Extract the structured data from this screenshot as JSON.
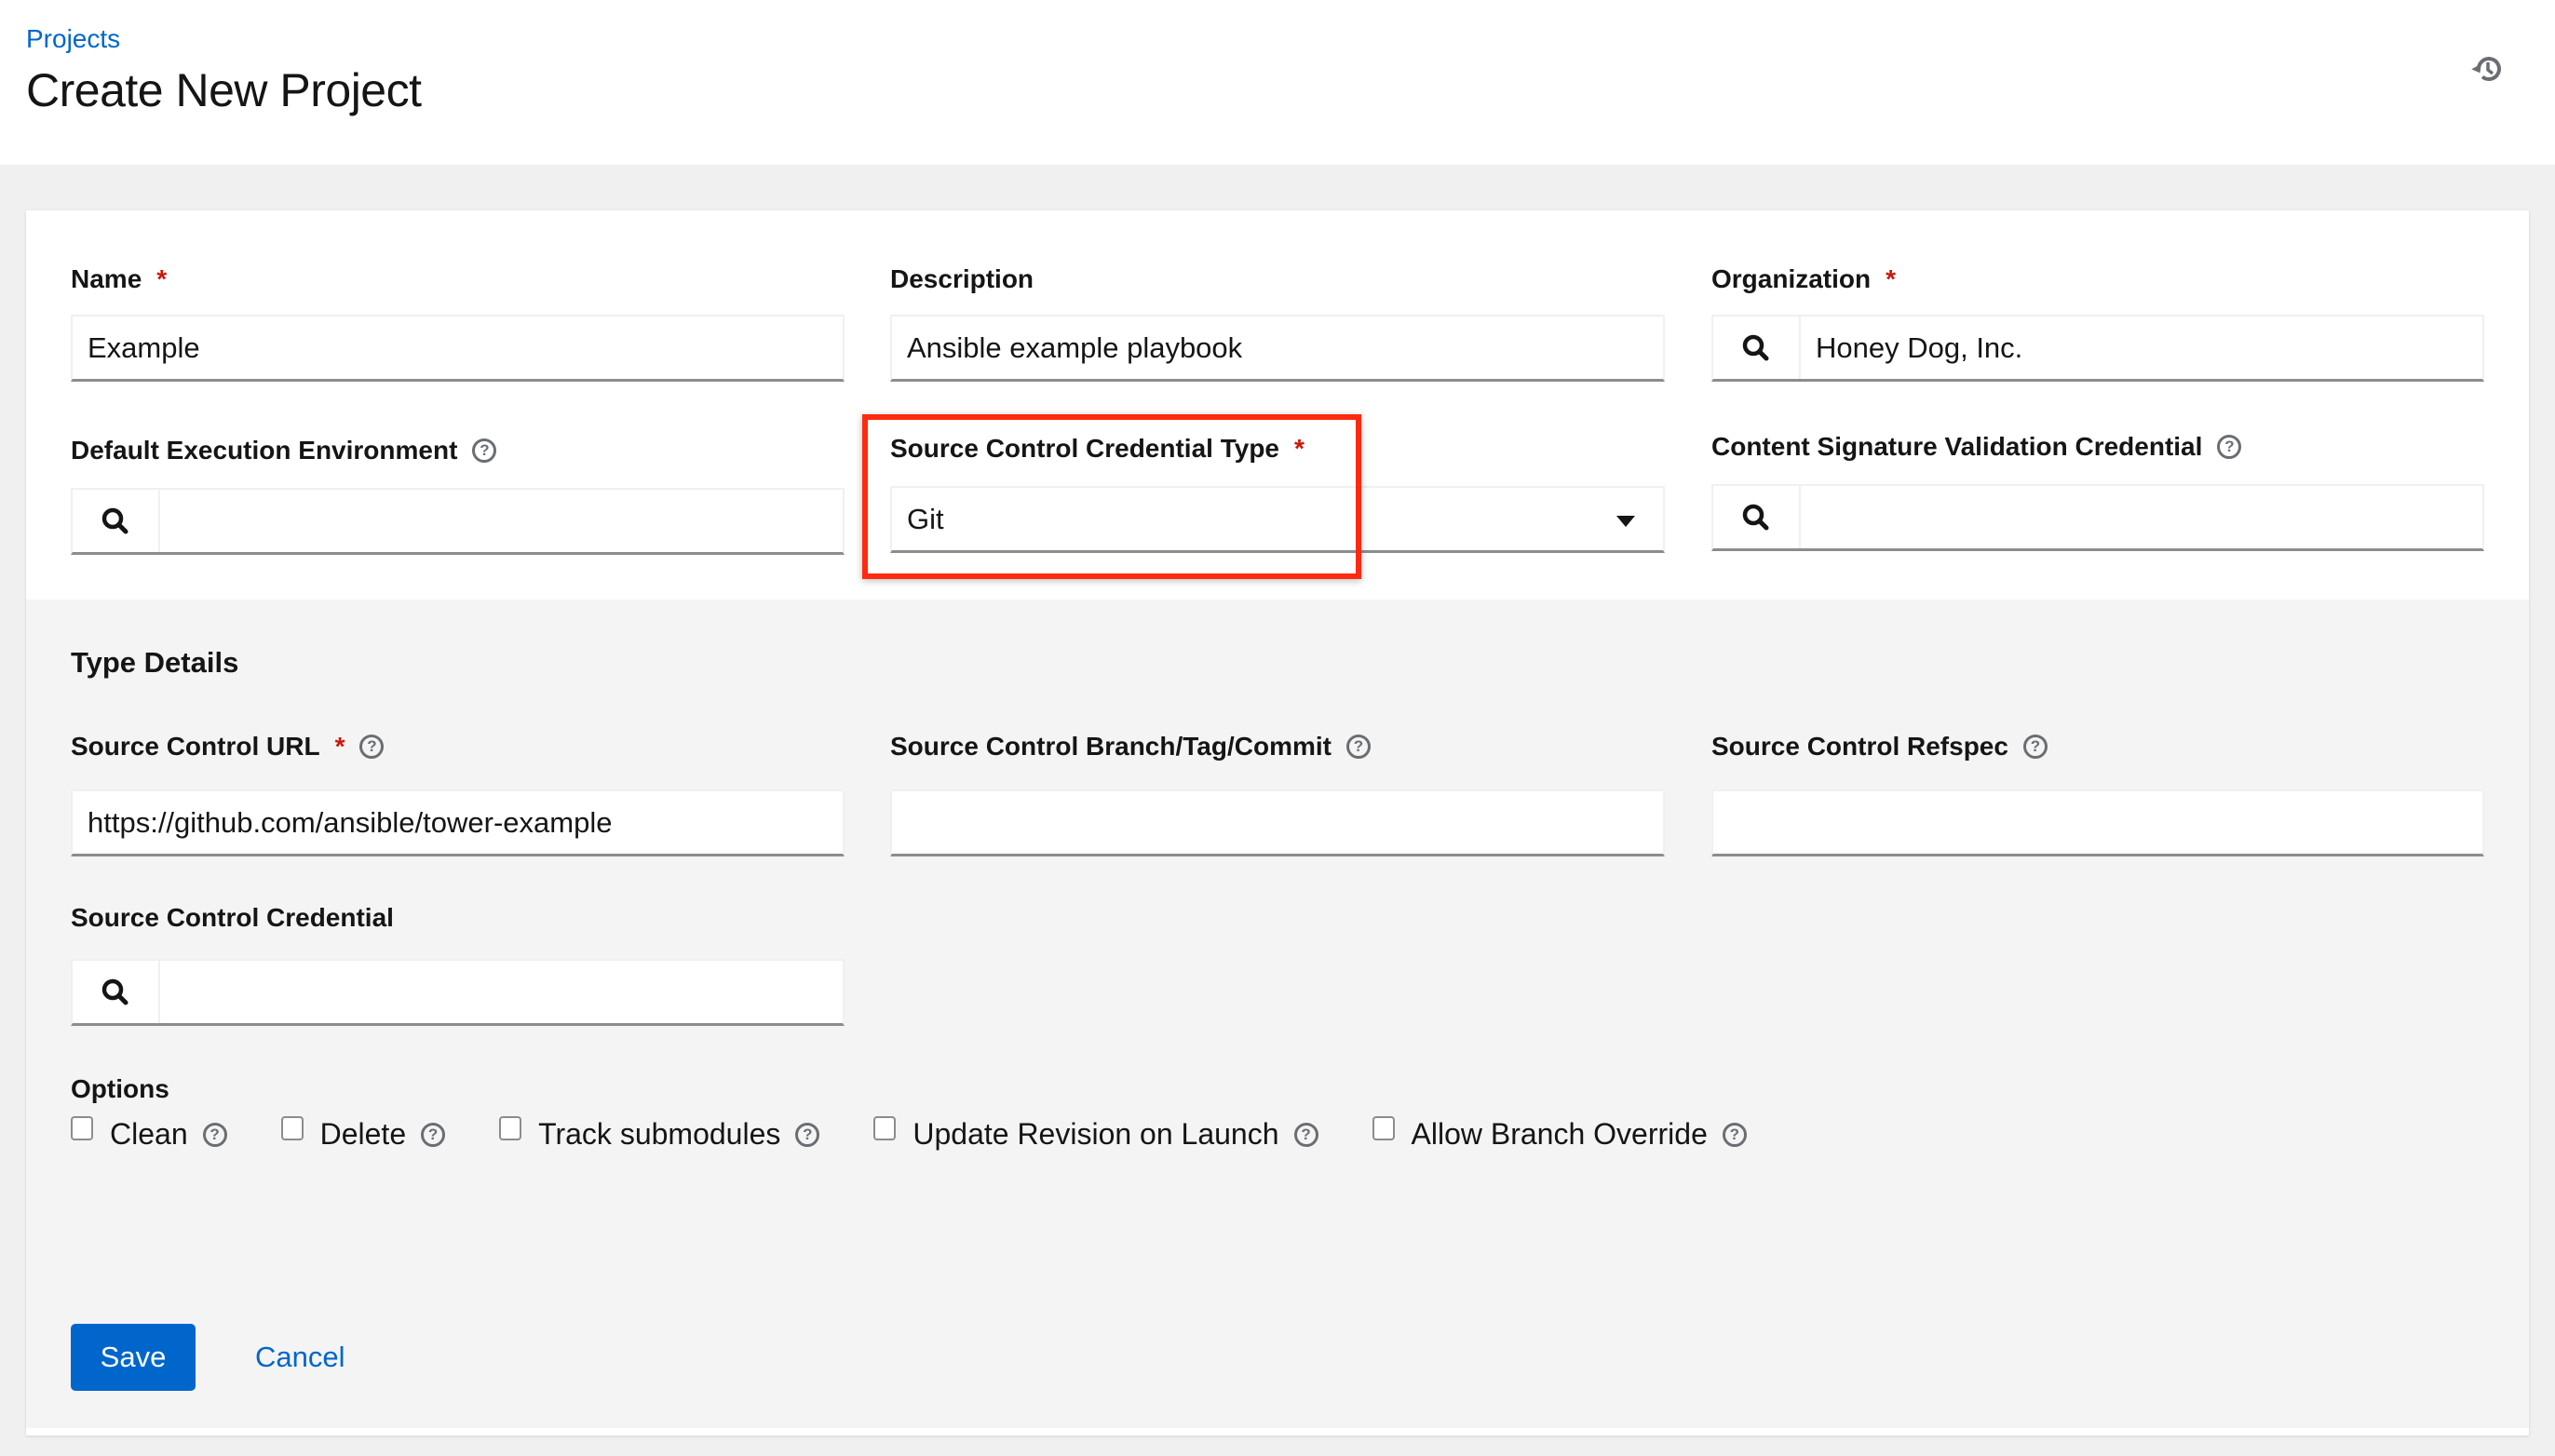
{
  "header": {
    "breadcrumb": "Projects",
    "title": "Create New Project",
    "history_icon": "history-icon"
  },
  "fields": {
    "name": {
      "label": "Name",
      "required": "*",
      "value": "Example"
    },
    "description": {
      "label": "Description",
      "value": "Ansible example playbook"
    },
    "organization": {
      "label": "Organization",
      "required": "*",
      "value": "Honey Dog, Inc."
    },
    "execution_env": {
      "label": "Default Execution Environment",
      "value": ""
    },
    "scm_type": {
      "label": "Source Control Credential Type",
      "required": "*",
      "value": "Git"
    },
    "signature_cred": {
      "label": "Content Signature Validation Credential",
      "value": ""
    }
  },
  "type_details": {
    "title": "Type Details",
    "scm_url": {
      "label": "Source Control URL",
      "required": "*",
      "value": "https://github.com/ansible/tower-example"
    },
    "scm_branch": {
      "label": "Source Control Branch/Tag/Commit",
      "value": ""
    },
    "scm_refspec": {
      "label": "Source Control Refspec",
      "value": ""
    },
    "scm_credential": {
      "label": "Source Control Credential",
      "value": ""
    },
    "options_label": "Options",
    "options": [
      {
        "label": "Clean",
        "checked": false
      },
      {
        "label": "Delete",
        "checked": false
      },
      {
        "label": "Track submodules",
        "checked": false
      },
      {
        "label": "Update Revision on Launch",
        "checked": false
      },
      {
        "label": "Allow Branch Override",
        "checked": false
      }
    ]
  },
  "help_glyph": "?",
  "actions": {
    "save": "Save",
    "cancel": "Cancel"
  },
  "colors": {
    "primary": "#0066cc",
    "required": "#c9190b",
    "highlight": "#ff2a0f"
  }
}
